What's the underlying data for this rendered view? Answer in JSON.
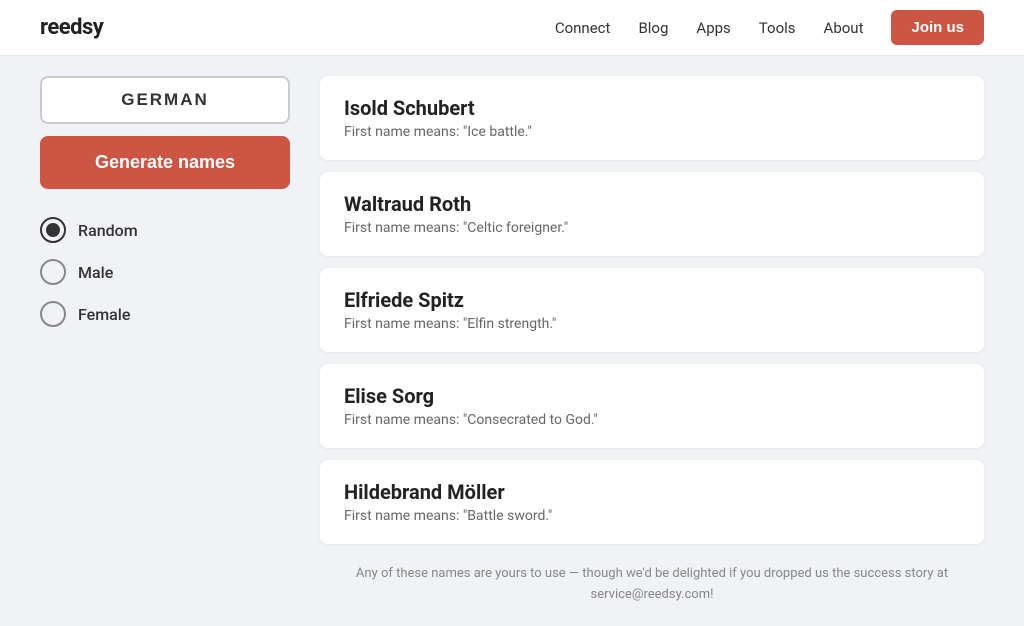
{
  "header": {
    "logo": "reedsy",
    "nav": {
      "connect": "Connect",
      "blog": "Blog",
      "apps": "Apps",
      "tools": "Tools",
      "about": "About",
      "join": "Join us"
    }
  },
  "sidebar": {
    "nationality": "GERMAN",
    "generate_label": "Generate names",
    "gender_options": [
      {
        "id": "random",
        "label": "Random",
        "selected": true
      },
      {
        "id": "male",
        "label": "Male",
        "selected": false
      },
      {
        "id": "female",
        "label": "Female",
        "selected": false
      }
    ]
  },
  "names": [
    {
      "name": "Isold Schubert",
      "description": "First name means: \"Ice battle.\""
    },
    {
      "name": "Waltraud Roth",
      "description": "First name means: \"Celtic foreigner.\""
    },
    {
      "name": "Elfriede Spitz",
      "description": "First name means: \"Elfin strength.\""
    },
    {
      "name": "Elise Sorg",
      "description": "First name means: \"Consecrated to God.\""
    },
    {
      "name": "Hildebrand Möller",
      "description": "First name means: \"Battle sword.\""
    }
  ],
  "footer_note": "Any of these names are yours to use — though we'd be delighted if you dropped us the success story at service@reedsy.com!"
}
